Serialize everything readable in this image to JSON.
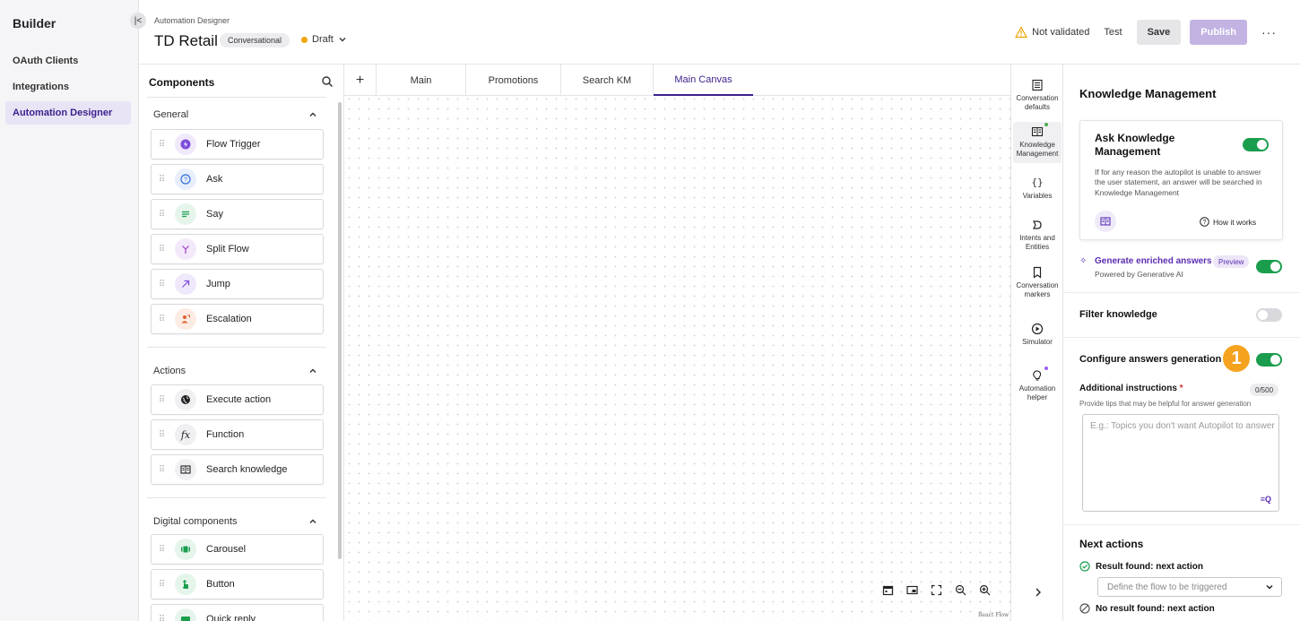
{
  "app": {
    "brand": "Builder"
  },
  "leftnav": {
    "items": [
      {
        "label": "OAuth Clients",
        "active": false
      },
      {
        "label": "Integrations",
        "active": false
      },
      {
        "label": "Automation Designer",
        "active": true
      }
    ]
  },
  "header": {
    "breadcrumb": "Automation Designer",
    "title": "TD Retail",
    "tag": "Conversational",
    "status": "Draft",
    "validation": "Not validated",
    "test_label": "Test",
    "save_label": "Save",
    "publish_label": "Publish",
    "more_label": "···"
  },
  "components": {
    "title": "Components",
    "sections": [
      {
        "title": "General",
        "items": [
          {
            "label": "Flow Trigger",
            "icon": "flow-trigger-icon",
            "color": "#7c4ddc"
          },
          {
            "label": "Ask",
            "icon": "ask-icon",
            "color": "#2f6fd8"
          },
          {
            "label": "Say",
            "icon": "say-icon",
            "color": "#1a9e4e"
          },
          {
            "label": "Split Flow",
            "icon": "split-flow-icon",
            "color": "#9b3cc8"
          },
          {
            "label": "Jump",
            "icon": "jump-icon",
            "color": "#7c4ddc"
          },
          {
            "label": "Escalation",
            "icon": "escalation-icon",
            "color": "#e0602c"
          }
        ]
      },
      {
        "title": "Actions",
        "items": [
          {
            "label": "Execute action",
            "icon": "globe-icon",
            "color": "#222222"
          },
          {
            "label": "Function",
            "icon": "function-icon",
            "color": "#222222"
          },
          {
            "label": "Search knowledge",
            "icon": "book-icon",
            "color": "#222222"
          }
        ]
      },
      {
        "title": "Digital components",
        "items": [
          {
            "label": "Carousel",
            "icon": "carousel-icon",
            "color": "#1a9e4e"
          },
          {
            "label": "Button",
            "icon": "button-icon",
            "color": "#1a9e4e"
          },
          {
            "label": "Quick reply",
            "icon": "quick-reply-icon",
            "color": "#1a9e4e"
          }
        ]
      }
    ]
  },
  "canvas": {
    "tabs": [
      {
        "label": "Main",
        "active": false
      },
      {
        "label": "Promotions",
        "active": false
      },
      {
        "label": "Search KM",
        "active": false
      },
      {
        "label": "Main Canvas",
        "active": true
      }
    ],
    "attribution": "React Flow"
  },
  "rail": {
    "items": [
      {
        "label": "Conversation defaults",
        "icon": "list-icon"
      },
      {
        "label": "Knowledge Management",
        "icon": "book-icon",
        "active": true
      },
      {
        "label": "Variables",
        "icon": "braces-icon"
      },
      {
        "label": "Intents and Entities",
        "icon": "intent-icon"
      },
      {
        "label": "Conversation markers",
        "icon": "bookmark-icon"
      },
      {
        "label": "Simulator",
        "icon": "play-icon"
      },
      {
        "label": "Automation helper",
        "icon": "lightbulb-icon"
      }
    ]
  },
  "settings": {
    "title": "Knowledge Management",
    "ask_km": {
      "title": "Ask Knowledge Management",
      "enabled": true,
      "description": "If for any reason the autopilot is unable to answer the user statement, an answer will be searched in Knowledge Management",
      "how_label": "How it works"
    },
    "enriched": {
      "label": "Generate enriched answers",
      "badge": "Preview",
      "sub": "Powered by Generative AI",
      "enabled": true
    },
    "filter": {
      "label": "Filter knowledge",
      "enabled": false
    },
    "configure": {
      "label": "Configure answers generation",
      "enabled": true,
      "marker": "1"
    },
    "additional": {
      "label": "Additional instructions",
      "required": "*",
      "count": "0/500",
      "hint": "Provide tips that may be helpful for answer generation",
      "placeholder": "E.g.: Topics you don't want Autopilot to answer",
      "icon_label": "≡Q"
    },
    "next_actions": {
      "title": "Next actions",
      "found_label": "Result found: next action",
      "found_placeholder": "Define the flow to be triggered",
      "notfound_label": "No result found: next action"
    }
  },
  "colors": {
    "accent": "#3c1f8c",
    "toggle_on": "#1a9e4e",
    "marker": "#f5a31f",
    "publish_disabled": "#c3b3e3"
  }
}
